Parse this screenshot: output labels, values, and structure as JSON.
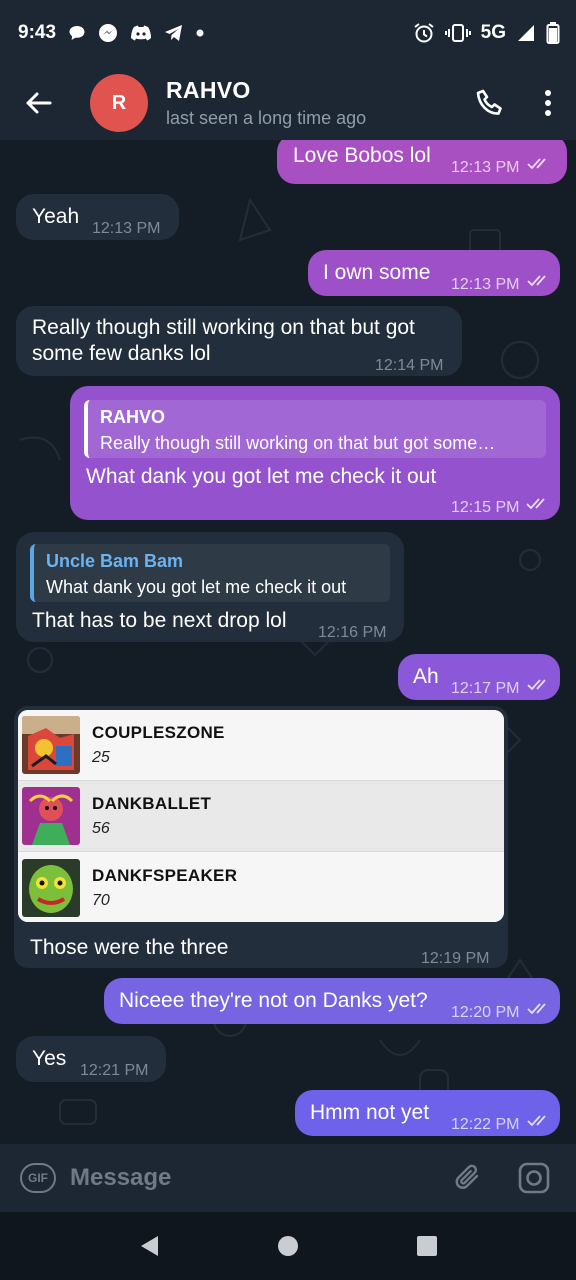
{
  "status_bar": {
    "time": "9:43",
    "network": "5G"
  },
  "header": {
    "avatar_letter": "R",
    "title": "RAHVO",
    "status": "last seen a long time ago"
  },
  "messages": [
    {
      "dir": "out",
      "text": "Love Bobos lol",
      "time": "12:13 PM"
    },
    {
      "dir": "in",
      "text": "Yeah",
      "time": "12:13 PM"
    },
    {
      "dir": "out",
      "text": "I own some",
      "time": "12:13 PM"
    },
    {
      "dir": "in",
      "text_line1": "Really though still working on that but got",
      "text_line2": "some few danks lol",
      "time": "12:14 PM"
    },
    {
      "dir": "out",
      "reply_name": "RAHVO",
      "reply_text": "Really though still working on that but got some…",
      "text": "What dank you got let me check it out",
      "time": "12:15 PM"
    },
    {
      "dir": "in",
      "reply_name": "Uncle Bam Bam",
      "reply_text": "What dank you got let me check it out",
      "text": "That has to be next drop lol",
      "time": "12:16 PM"
    },
    {
      "dir": "out",
      "text": "Ah",
      "time": "12:17 PM"
    },
    {
      "dir": "in",
      "text": "Those were the three",
      "time": "12:19 PM"
    },
    {
      "dir": "out",
      "text": "Niceee they're not on Danks yet?",
      "time": "12:20 PM"
    },
    {
      "dir": "in",
      "text": "Yes",
      "time": "12:21 PM"
    },
    {
      "dir": "out",
      "text": "Hmm not yet",
      "time": "12:22 PM"
    }
  ],
  "shared_list": [
    {
      "name": "COUPLESZONE",
      "count": "25"
    },
    {
      "name": "DANKBALLET",
      "count": "56"
    },
    {
      "name": "DANKFSPEAKER",
      "count": "70"
    }
  ],
  "input": {
    "gif_label": "GIF",
    "placeholder": "Message"
  },
  "colors": {
    "out_bubble_top": "#a14ec5",
    "out_bubble_bottom": "#6e62ea",
    "in_bubble": "#232e3c",
    "avatar": "#e0534f"
  }
}
